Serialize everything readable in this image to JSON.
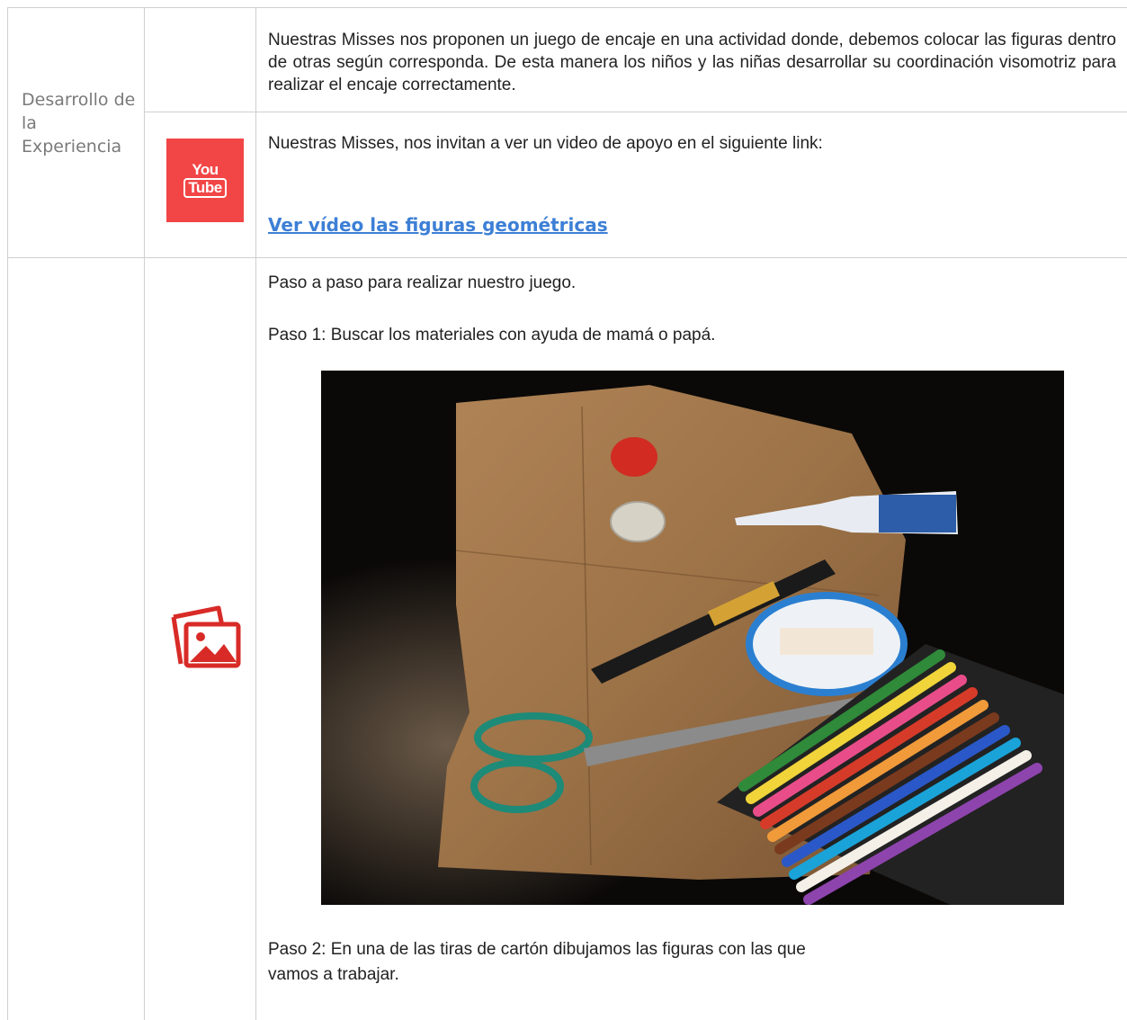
{
  "section_label": "Desarrollo de la Experiencia",
  "row1": {
    "text": "Nuestras Misses nos proponen un juego de encaje en una actividad donde, debemos colocar las figuras dentro de otras según corresponda. De esta manera los niños y las niñas desarrollar su coordinación visomotriz  para realizar el encaje correctamente."
  },
  "row2": {
    "icon": "youtube-icon",
    "icon_text_top": "You",
    "icon_text_bottom": "Tube",
    "text": "Nuestras Misses, nos invitan a ver un video de apoyo en el siguiente link:",
    "link_text": "Ver vídeo las figuras geométricas"
  },
  "row3": {
    "icon": "image-gallery-icon",
    "intro": "Paso a paso para realizar nuestro juego.",
    "step1": "Paso 1: Buscar los materiales con ayuda de mamá o papá.",
    "photo_alt": "Materiales: cartón, tapas, pegamento, plumón, tijeras y lápices de colores",
    "step2": "Paso 2: En una de las tiras de cartón dibujamos las figuras con las que vamos a trabajar."
  },
  "colors": {
    "border": "#cfcfcf",
    "label_text": "#7a7a7a",
    "link": "#3d7fd6",
    "youtube_red": "#f24646",
    "image_icon_red": "#d82b27"
  }
}
